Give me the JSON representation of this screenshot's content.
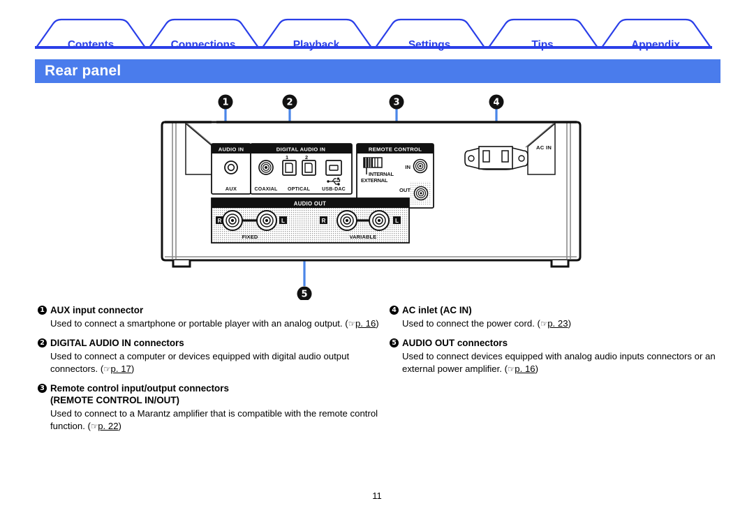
{
  "nav": {
    "tabs": [
      {
        "label": "Contents",
        "center": 130
      },
      {
        "label": "Connections",
        "center": 291
      },
      {
        "label": "Playback",
        "center": 453
      },
      {
        "label": "Settings",
        "center": 615
      },
      {
        "label": "Tips",
        "center": 777
      },
      {
        "label": "Appendix",
        "center": 939
      }
    ],
    "accent_color": "#2A3FE8"
  },
  "header": {
    "title": "Rear panel",
    "bar_color": "#4A7CEC",
    "text_color": "#FFFFFF"
  },
  "figure": {
    "alt": "Rear panel of audio component showing connector blocks",
    "callouts": [
      {
        "number": "1",
        "target": "AUDIO IN / AUX"
      },
      {
        "number": "2",
        "target": "DIGITAL AUDIO IN"
      },
      {
        "number": "3",
        "target": "REMOTE CONTROL"
      },
      {
        "number": "4",
        "target": "AC IN"
      },
      {
        "number": "5",
        "target": "AUDIO OUT"
      }
    ],
    "leader_color": "#4A86E8",
    "panel_labels": {
      "audio_in": "AUDIO IN",
      "aux": "AUX",
      "digital_audio_in": "DIGITAL AUDIO IN",
      "coaxial": "COAXIAL",
      "optical": "OPTICAL",
      "optical_1": "1",
      "optical_2": "2",
      "usb_dac": "USB-DAC",
      "remote_control": "REMOTE CONTROL",
      "internal": "INTERNAL",
      "external": "EXTERNAL",
      "remote_in": "IN",
      "remote_out": "OUT",
      "ac_in": "AC IN",
      "audio_out": "AUDIO OUT",
      "fixed": "FIXED",
      "variable": "VARIABLE",
      "ch_r": "R",
      "ch_l": "L"
    }
  },
  "descriptions": {
    "left": [
      {
        "number": "1",
        "title": "AUX input connector",
        "body": "Used to connect a smartphone or portable player with an analog output.",
        "ref_page": "p. 16"
      },
      {
        "number": "2",
        "title": "DIGITAL AUDIO IN connectors",
        "body": "Used to connect a computer or devices equipped with digital audio output connectors.",
        "ref_page": "p. 17"
      },
      {
        "number": "3",
        "title": "Remote control input/output connectors (REMOTE CONTROL IN/OUT)",
        "title_line1": "Remote control input/output connectors",
        "title_line2": "(REMOTE CONTROL IN/OUT)",
        "body": "Used to connect to a Marantz amplifier that is compatible with the remote control function.",
        "ref_page": "p. 22"
      }
    ],
    "right": [
      {
        "number": "4",
        "title": "AC inlet (AC IN)",
        "body": "Used to connect the power cord.",
        "ref_page": "p. 23"
      },
      {
        "number": "5",
        "title": "AUDIO OUT connectors",
        "body": "Used to connect devices equipped with analog audio inputs connectors or an external power amplifier.",
        "ref_page": "p. 16"
      }
    ]
  },
  "footer": {
    "page_number": "11"
  }
}
